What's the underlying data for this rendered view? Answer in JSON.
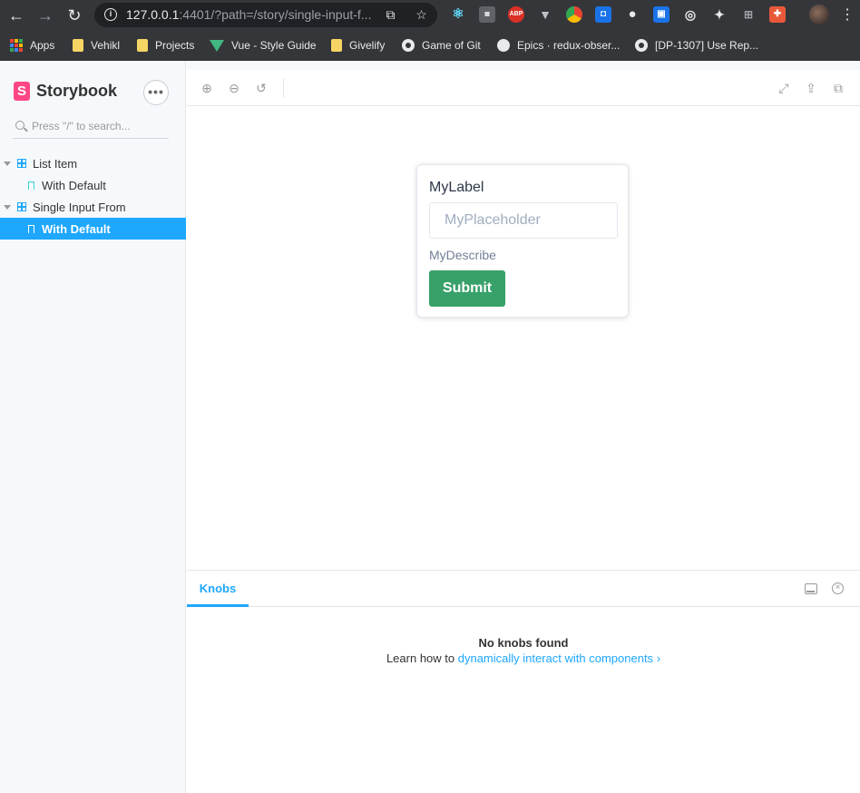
{
  "browser": {
    "url_host": "127.0.0.1",
    "url_rest": ":4401/?path=/story/single-input-f...",
    "ext_abp": "ABP"
  },
  "bookmarks": [
    {
      "label": "Apps",
      "icon": "apps-icon"
    },
    {
      "label": "Vehikl",
      "icon": "folder-icon"
    },
    {
      "label": "Projects",
      "icon": "folder-icon"
    },
    {
      "label": "Vue - Style Guide",
      "icon": "vue-icon"
    },
    {
      "label": "Givelify",
      "icon": "folder-icon"
    },
    {
      "label": "Game of Git",
      "icon": "github-icon"
    },
    {
      "label": "Epics · redux-obser...",
      "icon": "globe-icon"
    },
    {
      "label": "[DP-1307] Use Rep...",
      "icon": "github-icon"
    }
  ],
  "sidebar": {
    "brand": "Storybook",
    "brand_mark": "S",
    "more_label": "•••",
    "search_placeholder": "Press \"/\" to search...",
    "tree": [
      {
        "label": "List Item",
        "type": "component"
      },
      {
        "label": "With Default",
        "type": "story"
      },
      {
        "label": "Single Input From",
        "type": "component"
      },
      {
        "label": "With Default",
        "type": "story",
        "selected": true
      }
    ]
  },
  "preview": {
    "form": {
      "label": "MyLabel",
      "placeholder": "MyPlaceholder",
      "describe": "MyDescribe",
      "submit": "Submit"
    }
  },
  "panel": {
    "tab": "Knobs",
    "empty_title": "No knobs found",
    "empty_text": "Learn how to ",
    "empty_link": "dynamically interact with components",
    "empty_link_arrow": "›"
  },
  "colors": {
    "accent": "#1ea7fd",
    "brand": "#ff4785",
    "submit": "#38a169"
  }
}
